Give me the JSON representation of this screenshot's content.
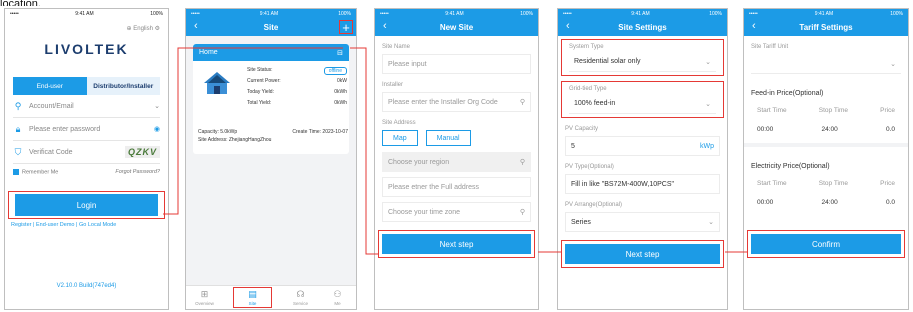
{
  "caption": "location.",
  "status": {
    "time": "9:41 AM",
    "battery": "100%",
    "signal": "•••••"
  },
  "colors": {
    "primary": "#1c9be6",
    "highlight": "#e53935",
    "dark": "#1c3d6e"
  },
  "login": {
    "language": "English",
    "logo": "LIVOLTEK",
    "tab_enduser": "End-user",
    "tab_distributor": "Distributor/Installer",
    "account_placeholder": "Account/Email",
    "password_placeholder": "Please enter password",
    "captcha_placeholder": "Verificat Code",
    "captcha_text": "QZKV",
    "remember": "Remember Me",
    "forgot": "Forgot Password?",
    "login_button": "Login",
    "links": "Register | End-user Demo | Go Local Mode",
    "version": "V2.10.0 Build(747ed4)"
  },
  "site": {
    "title": "Site",
    "card_title": "Home",
    "status_label": "Site Status:",
    "status_value": "offline",
    "power_label": "Current Power:",
    "power_value": "0kW",
    "today_label": "Today Yield:",
    "today_value": "0kWh",
    "total_label": "Total Yield:",
    "total_value": "0kWh",
    "capacity": "Capacity: 5.0kWp",
    "create_time": "Create Time: 2023-10-07",
    "address": "Site Address: ZhejiangHangZhou",
    "tabs": [
      {
        "label": "Overview",
        "icon": "grid-icon"
      },
      {
        "label": "Site",
        "icon": "document-icon"
      },
      {
        "label": "Service",
        "icon": "headset-icon"
      },
      {
        "label": "Me",
        "icon": "user-icon"
      }
    ]
  },
  "new_site": {
    "title": "New Site",
    "name_label": "Site Name",
    "name_placeholder": "Please input",
    "installer_label": "Installer",
    "installer_placeholder": "Please enter the Installer Org Code",
    "address_label": "Site Address",
    "map_button": "Map",
    "manual_button": "Manual",
    "region_placeholder": "Choose your region",
    "full_address_placeholder": "Please etner the Full address",
    "timezone_placeholder": "Choose your time zone",
    "next_button": "Next step"
  },
  "site_settings": {
    "title": "Site Settings",
    "system_type_label": "System Type",
    "system_type_value": "Residential solar only",
    "grid_type_label": "Grid-tied Type",
    "grid_type_value": "100% feed-in",
    "pv_capacity_label": "PV Capacity",
    "pv_capacity_value": "5",
    "pv_capacity_unit": "kWp",
    "pv_type_label": "PV Type(Optional)",
    "pv_type_value": "Fill in like  \"BS72M-400W,10PCS\"",
    "pv_arrange_label": "PV Arrange(Optional)",
    "pv_arrange_value": "Series",
    "next_button": "Next step"
  },
  "tariff": {
    "title": "Tariff Settings",
    "unit_label": "Site Tariff Unit",
    "feedin_title": "Feed-in Price(Optional)",
    "elec_title": "Electricity Price(Optional)",
    "col_start": "Start Time",
    "col_stop": "Stop Time",
    "col_price": "Price",
    "feedin_row": {
      "start": "00:00",
      "stop": "24:00",
      "price": "0.0"
    },
    "elec_row": {
      "start": "00:00",
      "stop": "24:00",
      "price": "0.0"
    },
    "confirm_button": "Confirm"
  }
}
